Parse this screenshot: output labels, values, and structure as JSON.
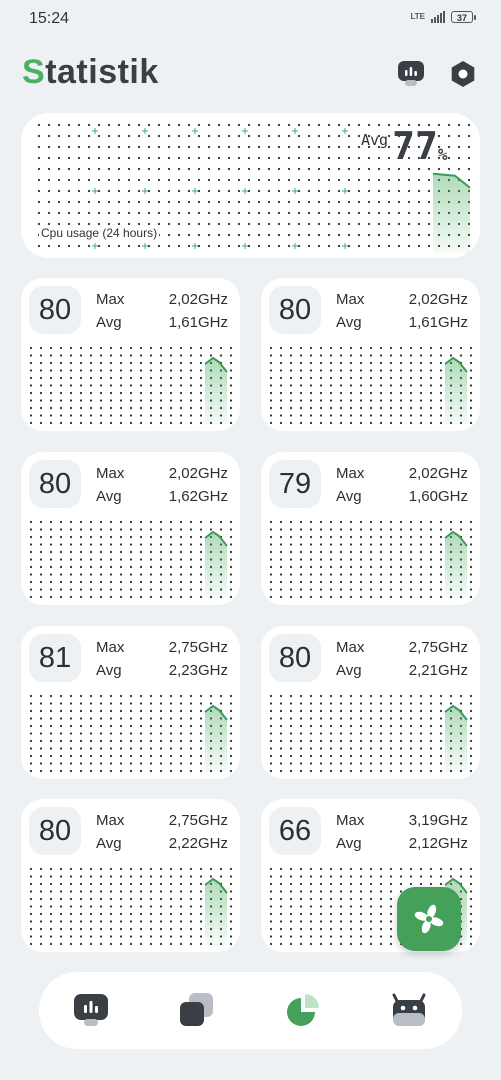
{
  "status_bar": {
    "time": "15:24",
    "network": "LTE",
    "battery": "37"
  },
  "header": {
    "title_first": "S",
    "title_rest": "tatistik"
  },
  "cpu_usage": {
    "avg_label": "Avg",
    "avg_value": "77",
    "unit": "%",
    "caption": "Cpu usage (24 hours)",
    "current_level": 0.77
  },
  "cores": [
    {
      "temp": "80",
      "max_label": "Max",
      "max": "2,02GHz",
      "avg_label": "Avg",
      "avg": "1,61GHz"
    },
    {
      "temp": "80",
      "max_label": "Max",
      "max": "2,02GHz",
      "avg_label": "Avg",
      "avg": "1,61GHz"
    },
    {
      "temp": "80",
      "max_label": "Max",
      "max": "2,02GHz",
      "avg_label": "Avg",
      "avg": "1,62GHz"
    },
    {
      "temp": "79",
      "max_label": "Max",
      "max": "2,02GHz",
      "avg_label": "Avg",
      "avg": "1,60GHz"
    },
    {
      "temp": "81",
      "max_label": "Max",
      "max": "2,75GHz",
      "avg_label": "Avg",
      "avg": "2,23GHz"
    },
    {
      "temp": "80",
      "max_label": "Max",
      "max": "2,75GHz",
      "avg_label": "Avg",
      "avg": "2,21GHz"
    },
    {
      "temp": "80",
      "max_label": "Max",
      "max": "2,75GHz",
      "avg_label": "Avg",
      "avg": "2,22GHz"
    },
    {
      "temp": "66",
      "max_label": "Max",
      "max": "3,19GHz",
      "avg_label": "Avg",
      "avg": "2,12GHz"
    }
  ],
  "icons": {
    "header": [
      "monitor-icon",
      "gear-icon"
    ],
    "fab": "fan-icon",
    "nav": [
      "monitor-icon",
      "layers-icon",
      "pie-chart-icon",
      "android-icon"
    ]
  },
  "colors": {
    "accent": "#4caf63",
    "fab": "#45a05a",
    "text": "#2b2f33",
    "background": "#eef1f4"
  }
}
